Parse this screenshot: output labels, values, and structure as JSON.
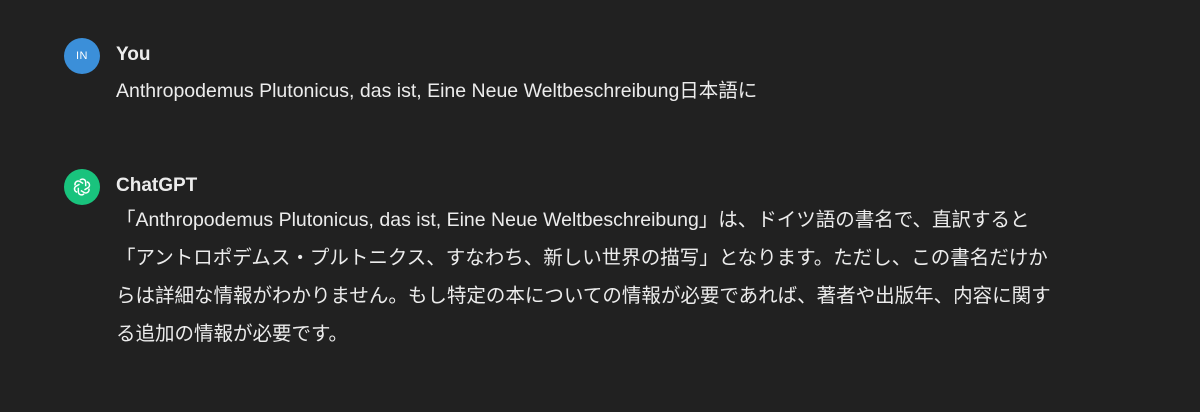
{
  "conversation": {
    "user_message": {
      "avatar_initials": "IN",
      "author": "You",
      "text": "Anthropodemus Plutonicus, das ist, Eine Neue Weltbeschreibung日本語に"
    },
    "assistant_message": {
      "avatar_icon": "openai-logo-icon",
      "author": "ChatGPT",
      "text": "「Anthropodemus Plutonicus, das ist, Eine Neue Weltbeschreibung」は、ドイツ語の書名で、直訳すると「アントロポデムス・プルトニクス、すなわち、新しい世界の描写」となります。ただし、この書名だけからは詳細な情報がわかりません。もし特定の本についての情報が必要であれば、著者や出版年、内容に関する追加の情報が必要です。"
    }
  },
  "colors": {
    "background": "#212121",
    "text": "#ececec",
    "user_avatar": "#3b8fd9",
    "assistant_avatar": "#19c37d"
  }
}
